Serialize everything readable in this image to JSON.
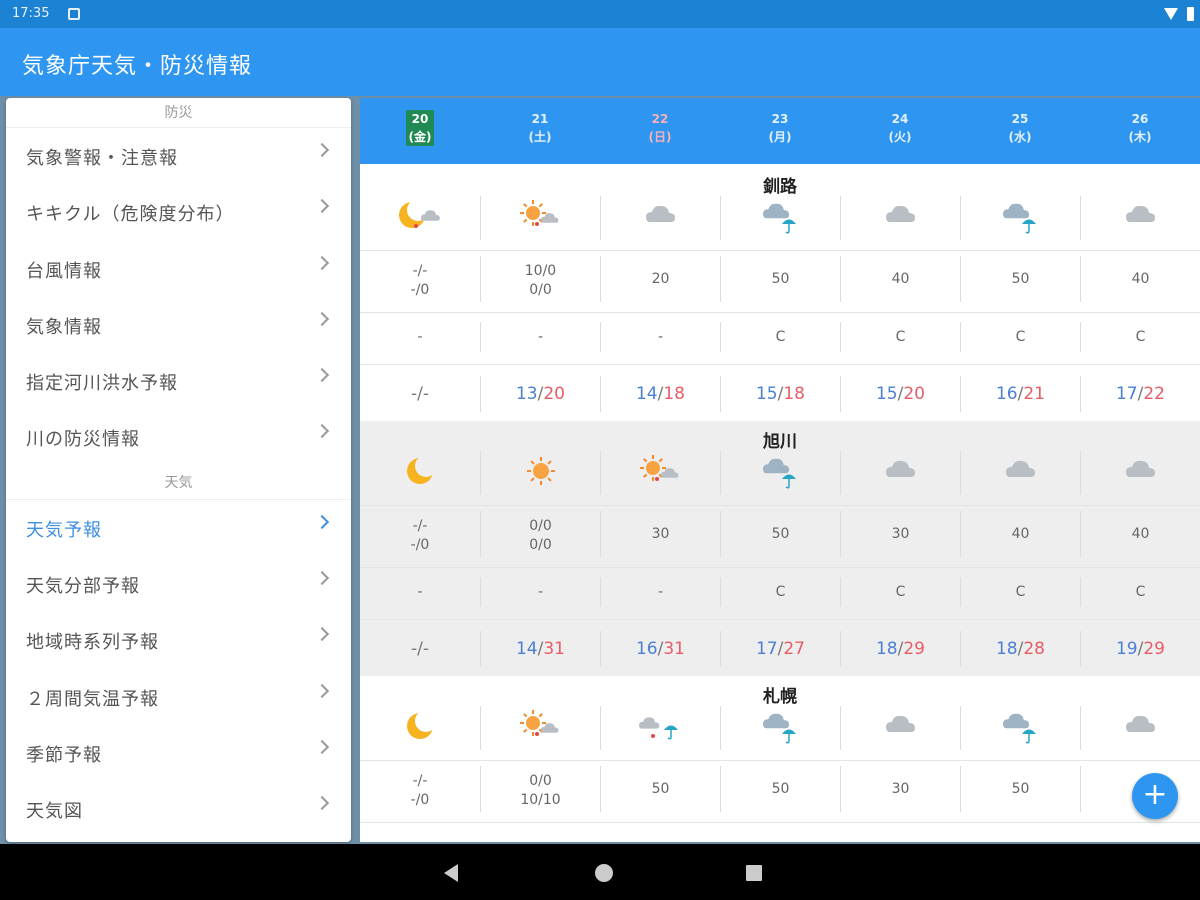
{
  "status_bar": {
    "time": "17:35"
  },
  "app_title": "気象庁天気・防災情報",
  "drawer": {
    "sections": [
      {
        "header": "防災",
        "items": [
          "気象警報・注意報",
          "キキクル（危険度分布）",
          "台風情報",
          "気象情報",
          "指定河川洪水予報",
          "川の防災情報"
        ]
      },
      {
        "header": "天気",
        "items": [
          "天気予報",
          "天気分部予報",
          "地域時系列予報",
          "２周間気温予報",
          "季節予報",
          "天気図"
        ]
      }
    ],
    "active_item": "天気予報"
  },
  "dates": [
    {
      "day": "20",
      "weekday": "(金)",
      "today": true
    },
    {
      "day": "21",
      "weekday": "(土)"
    },
    {
      "day": "22",
      "weekday": "(日)",
      "sunday": true
    },
    {
      "day": "23",
      "weekday": "(月)"
    },
    {
      "day": "24",
      "weekday": "(火)"
    },
    {
      "day": "25",
      "weekday": "(水)"
    },
    {
      "day": "26",
      "weekday": "(木)"
    }
  ],
  "cities": [
    {
      "name": "釧路",
      "icons": [
        "moon-cloud-icon",
        "sun-cloud-icon",
        "cloud-icon",
        "cloud-rain-icon",
        "cloud-icon",
        "cloud-rain-icon",
        "cloud-icon"
      ],
      "pop": [
        [
          "-/-",
          "-/0"
        ],
        [
          "10/0",
          "0/0"
        ],
        [
          "20"
        ],
        [
          "50"
        ],
        [
          "40"
        ],
        [
          "50"
        ],
        [
          "40"
        ]
      ],
      "reliability": [
        "-",
        "-",
        "-",
        "C",
        "C",
        "C",
        "C"
      ],
      "temps": [
        [
          "-/-"
        ],
        [
          "13",
          "20"
        ],
        [
          "14",
          "18"
        ],
        [
          "15",
          "18"
        ],
        [
          "15",
          "20"
        ],
        [
          "16",
          "21"
        ],
        [
          "17",
          "22"
        ]
      ]
    },
    {
      "name": "旭川",
      "icons": [
        "moon-icon",
        "sun-icon",
        "sun-cloud-icon",
        "cloud-rain-icon",
        "cloud-icon",
        "cloud-icon",
        "cloud-icon"
      ],
      "pop": [
        [
          "-/-",
          "-/0"
        ],
        [
          "0/0",
          "0/0"
        ],
        [
          "30"
        ],
        [
          "50"
        ],
        [
          "30"
        ],
        [
          "40"
        ],
        [
          "40"
        ]
      ],
      "reliability": [
        "-",
        "-",
        "-",
        "C",
        "C",
        "C",
        "C"
      ],
      "temps": [
        [
          "-/-"
        ],
        [
          "14",
          "31"
        ],
        [
          "16",
          "31"
        ],
        [
          "17",
          "27"
        ],
        [
          "18",
          "29"
        ],
        [
          "18",
          "28"
        ],
        [
          "19",
          "29"
        ]
      ]
    },
    {
      "name": "札幌",
      "icons": [
        "moon-icon",
        "sun-cloud-icon",
        "cloud-umbrella-icon",
        "cloud-rain-icon",
        "cloud-icon",
        "cloud-rain-icon",
        "cloud-icon"
      ],
      "pop": [
        [
          "-/-",
          "-/0"
        ],
        [
          "0/0",
          "10/10"
        ],
        [
          "50"
        ],
        [
          "50"
        ],
        [
          "30"
        ],
        [
          "50"
        ],
        [
          ""
        ]
      ],
      "reliability": [],
      "temps": []
    }
  ],
  "fab_label": "+"
}
